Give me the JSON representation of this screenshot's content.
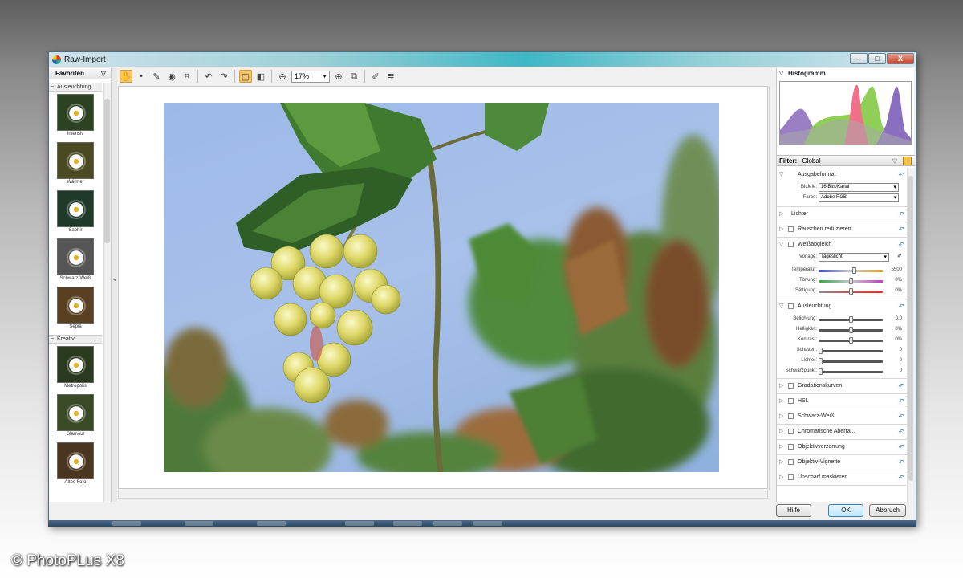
{
  "window": {
    "title": "Raw-Import",
    "buttons": [
      "–",
      "□",
      "X"
    ]
  },
  "toolbar": {
    "tools": [
      "hand-icon",
      "dropper-icon",
      "brush-icon",
      "retouch-icon",
      "crop-icon",
      "rotate-left-icon",
      "rotate-right-icon"
    ],
    "zoom_value": "17%"
  },
  "left_panel": {
    "tab": "Favoriten",
    "categories": [
      {
        "name": "Ausleuchtung",
        "presets": [
          "Intensiv",
          "Wärmer",
          "Saphir",
          "Schwarz-Weiß",
          "Sepia"
        ]
      },
      {
        "name": "Kreativ",
        "presets": [
          "Metropolis",
          "Glamour",
          "Altes Foto"
        ]
      }
    ]
  },
  "right_panel": {
    "histogram_title": "Histogramm",
    "filter_label": "Filter:",
    "filter_value": "Global",
    "ausgabeformat": {
      "title": "Ausgabeformat",
      "bittiefe_label": "Bittiefe:",
      "bittiefe_value": "16 Bits/Kanal",
      "farbe_label": "Farbe:",
      "farbe_value": "Adobe RGB"
    },
    "lichter_title": "Lichter",
    "rauschen_title": "Rauschen reduzieren",
    "weissabgleich": {
      "title": "Weißabgleich",
      "vorlage_label": "Vorlage:",
      "vorlage_value": "Tageslicht",
      "sliders": [
        {
          "label": "Temperatur:",
          "value": "5500",
          "level": 0.55
        },
        {
          "label": "Tönung:",
          "value": "0%",
          "level": 0.5
        },
        {
          "label": "Sättigung:",
          "value": "0%",
          "level": 0.5
        }
      ]
    },
    "ausleuchtung": {
      "title": "Ausleuchtung",
      "sliders": [
        {
          "label": "Belichtung:",
          "value": "0.0",
          "level": 0.5
        },
        {
          "label": "Helligkeit:",
          "value": "0%",
          "level": 0.5
        },
        {
          "label": "Kontrast:",
          "value": "0%",
          "level": 0.5
        },
        {
          "label": "Schatten:",
          "value": "0",
          "level": 0.0
        },
        {
          "label": "Lichter:",
          "value": "0",
          "level": 0.0
        },
        {
          "label": "Schwarzpunkt:",
          "value": "0",
          "level": 0.0
        }
      ]
    },
    "other_groups": [
      "Gradationskurven",
      "HSL",
      "Schwarz-Weiß",
      "Chromatische Aberra...",
      "Objektivverzerrung",
      "Objektiv-Vignette",
      "Unscharf maskieren"
    ]
  },
  "footer": {
    "help": "Hilfe",
    "ok": "OK",
    "cancel": "Abbruch"
  },
  "copyright": "© PhotoPLus X8"
}
